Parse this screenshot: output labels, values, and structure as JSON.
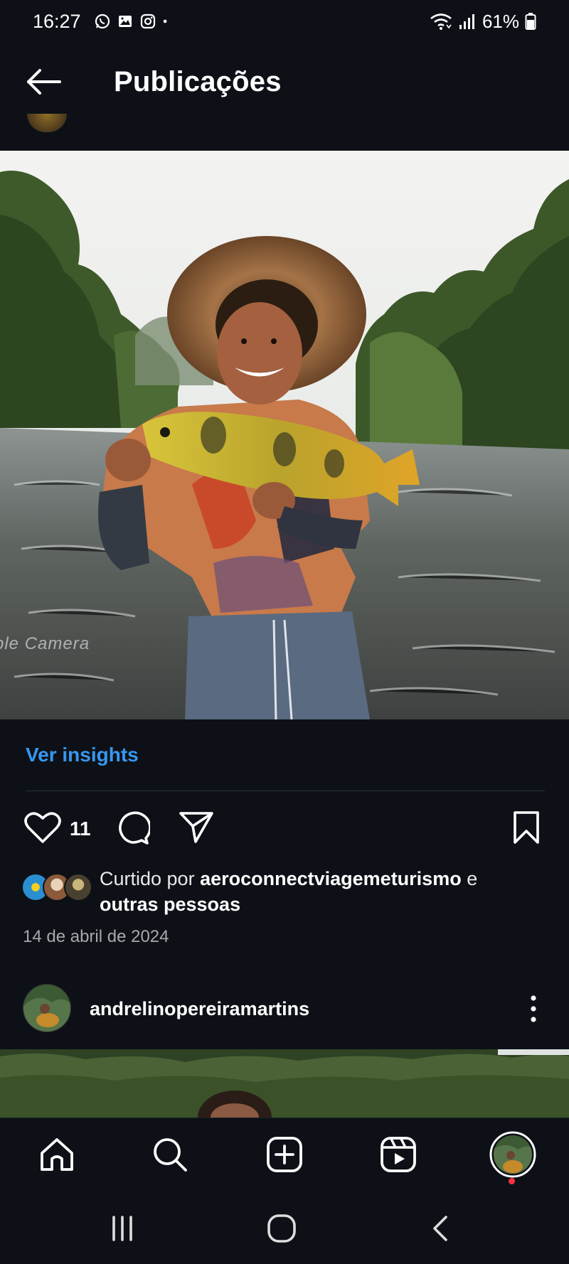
{
  "status_bar": {
    "time": "16:27",
    "app_icons": [
      "whatsapp-icon",
      "gallery-icon",
      "instagram-icon",
      "dot-icon"
    ],
    "battery": "61%",
    "right_icons": [
      "wifi-icon",
      "signal-icon",
      "battery-icon"
    ]
  },
  "header": {
    "title": "Publicações",
    "back_icon": "arrow-left-icon"
  },
  "post": {
    "watermark": "ple Camera",
    "insights_label": "Ver insights",
    "like_count": "11",
    "likers": {
      "prefix": "Curtido por ",
      "user": "aeroconnectviagemeturismo",
      "suffix": " e",
      "others": "outras pessoas"
    },
    "date": "14 de abril de 2024",
    "liked": false,
    "saved": false
  },
  "next_post": {
    "username": "andrelinopereiramartins"
  },
  "bottom_nav": {
    "items": [
      "home-icon",
      "search-icon",
      "create-icon",
      "reels-icon",
      "profile-avatar"
    ],
    "notification_dot_color": "#ff3040"
  },
  "system_nav": [
    "recents-button",
    "home-button",
    "back-button"
  ],
  "colors": {
    "background": "#0d1117",
    "link": "#3797f0",
    "text": "#ffffff",
    "muted": "#a8a8a8"
  }
}
